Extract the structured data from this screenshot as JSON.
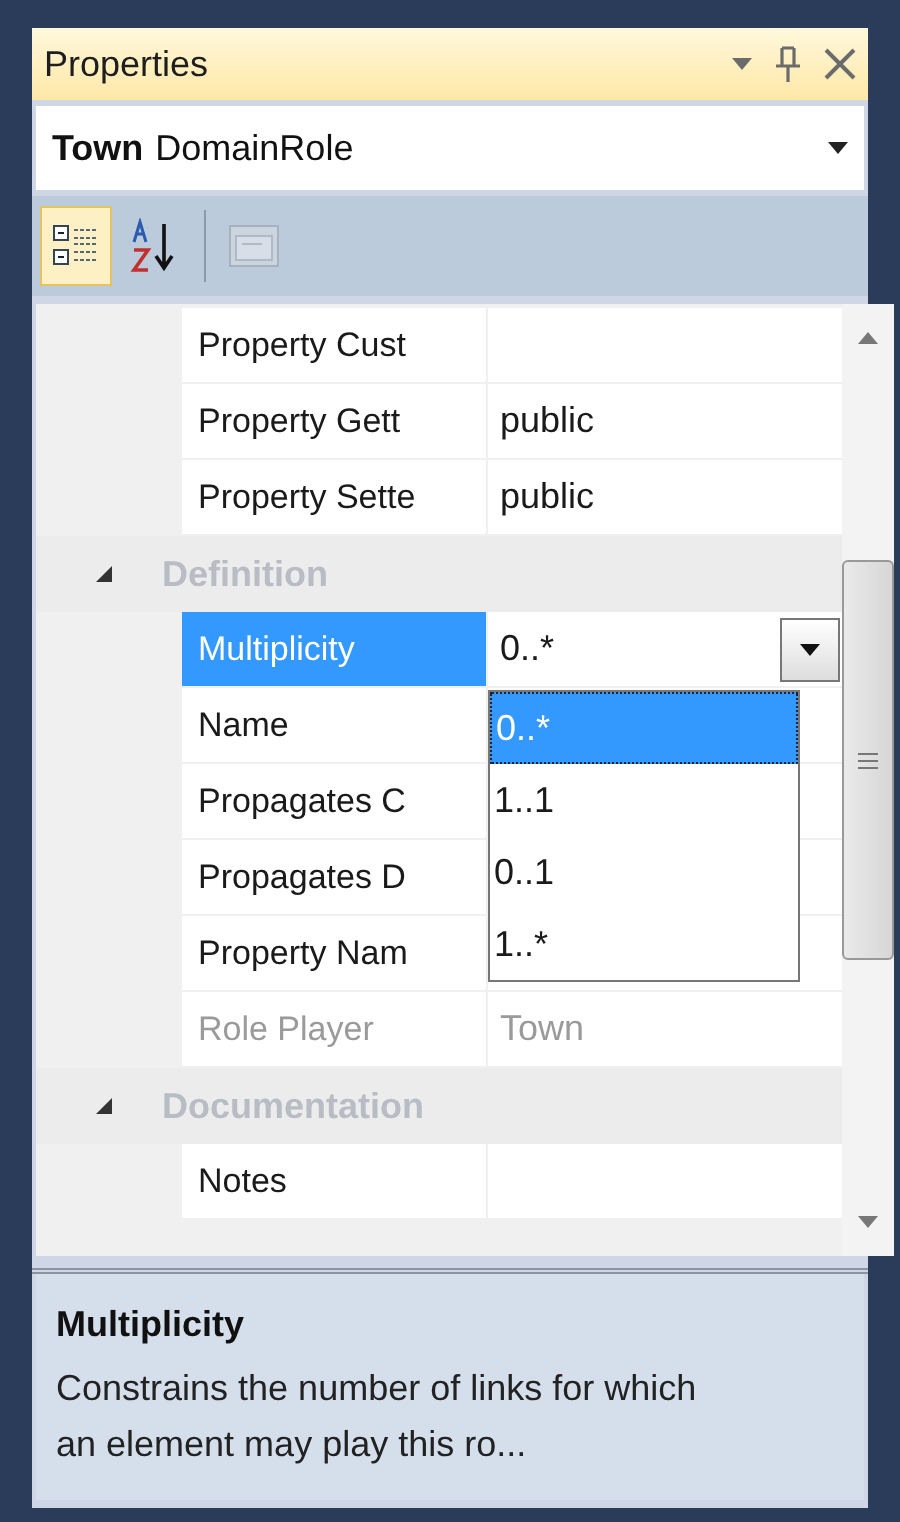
{
  "window": {
    "title": "Properties"
  },
  "object_selector": {
    "name": "Town",
    "type": "DomainRole"
  },
  "toolbar": [
    {
      "kind": "categorized",
      "selected": true
    },
    {
      "kind": "alphabetical",
      "selected": false
    },
    {
      "kind": "property-pages",
      "selected": false,
      "disabled": true
    }
  ],
  "grid": [
    {
      "kind": "property",
      "name": "Property Cust",
      "selected": false,
      "disabled": false
    },
    {
      "kind": "property",
      "name": "Property Gett",
      "value": "public",
      "selected": false,
      "disabled": false
    },
    {
      "kind": "property",
      "name": "Property Sette",
      "value": "public",
      "selected": false,
      "disabled": false
    },
    {
      "kind": "category",
      "name": "Definition",
      "expanded": true
    },
    {
      "kind": "property",
      "name": "Multiplicity",
      "value": "0..*",
      "selected": true,
      "disabled": false,
      "dropdown": true
    },
    {
      "kind": "property",
      "name": "Name",
      "selected": false,
      "disabled": false
    },
    {
      "kind": "property",
      "name": "Propagates C",
      "selected": false,
      "disabled": false
    },
    {
      "kind": "property",
      "name": "Propagates D",
      "selected": false,
      "disabled": false
    },
    {
      "kind": "property",
      "name": "Property Nam",
      "selected": false,
      "disabled": false
    },
    {
      "kind": "property",
      "name": "Role Player",
      "value": "Town",
      "selected": false,
      "disabled": true
    },
    {
      "kind": "category",
      "name": "Documentation",
      "expanded": true
    },
    {
      "kind": "property",
      "name": "Notes",
      "selected": false,
      "disabled": false
    }
  ],
  "dropdown_list": [
    {
      "label": "0..*",
      "selected": true
    },
    {
      "label": "1..1",
      "selected": false
    },
    {
      "label": "0..1",
      "selected": false
    },
    {
      "label": "1..*",
      "selected": false
    }
  ],
  "description": {
    "title": "Multiplicity",
    "text": "Constrains the number of links for which an element may play this ro..."
  }
}
